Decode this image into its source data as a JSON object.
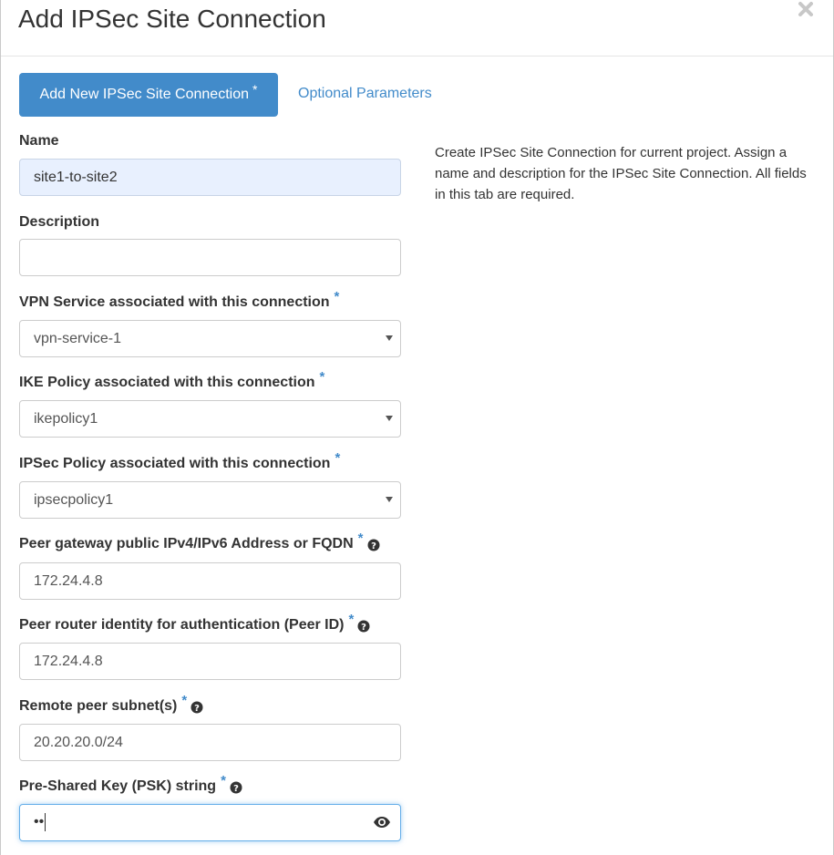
{
  "modal": {
    "title": "Add IPSec Site Connection"
  },
  "tabs": [
    {
      "label": "Add New IPSec Site Connection",
      "required_mark": "*",
      "active": true
    },
    {
      "label": "Optional Parameters",
      "active": false
    }
  ],
  "help_text": "Create IPSec Site Connection for current project. Assign a name and description for the IPSec Site Connection. All fields in this tab are required.",
  "fields": {
    "name": {
      "label": "Name",
      "value": "site1-to-site2"
    },
    "description": {
      "label": "Description",
      "value": ""
    },
    "vpn_service": {
      "label": "VPN Service associated with this connection",
      "required_mark": "*",
      "selected": "vpn-service-1"
    },
    "ike_policy": {
      "label": "IKE Policy associated with this connection",
      "required_mark": "*",
      "selected": "ikepolicy1"
    },
    "ipsec_policy": {
      "label": "IPSec Policy associated with this connection",
      "required_mark": "*",
      "selected": "ipsecpolicy1"
    },
    "peer_address": {
      "label": "Peer gateway public IPv4/IPv6 Address or FQDN",
      "required_mark": "*",
      "value": "172.24.4.8"
    },
    "peer_id": {
      "label": "Peer router identity for authentication (Peer ID)",
      "required_mark": "*",
      "value": "172.24.4.8"
    },
    "peer_cidrs": {
      "label": "Remote peer subnet(s)",
      "required_mark": "*",
      "value": "20.20.20.0/24"
    },
    "psk": {
      "label": "Pre-Shared Key (PSK) string",
      "required_mark": "*",
      "masked_value": "••"
    }
  },
  "colors": {
    "primary": "#428bca",
    "focus_border": "#66afe9",
    "autofill_bg": "#e8f0fe"
  },
  "icons": {
    "close": "close-icon",
    "help": "question-circle-icon",
    "eye": "eye-icon",
    "caret": "chevron-down-icon"
  }
}
